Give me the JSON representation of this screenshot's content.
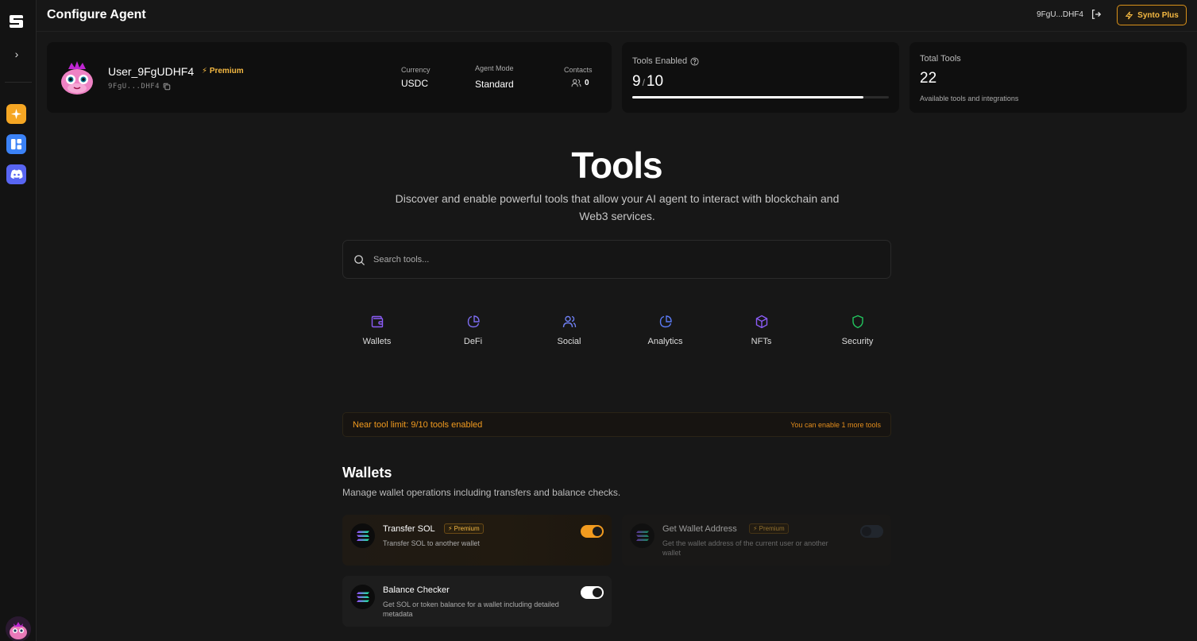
{
  "header": {
    "title": "Configure Agent",
    "wallet_short": "9FgU...DHF4",
    "plus_label": "Synto Plus"
  },
  "profile": {
    "username": "User_9FgUDHF4",
    "tier": "Premium",
    "address": "9FgU...DHF4",
    "currency_label": "Currency",
    "currency_value": "USDC",
    "mode_label": "Agent Mode",
    "mode_value": "Standard",
    "contacts_label": "Contacts",
    "contacts_value": "0"
  },
  "tools_enabled": {
    "label": "Tools Enabled",
    "enabled": "9",
    "separator": "/",
    "max": "10",
    "progress_fraction": 0.9
  },
  "total_tools": {
    "label": "Total Tools",
    "value": "22",
    "subtitle": "Available tools and integrations"
  },
  "hero": {
    "title": "Tools",
    "subtitle": "Discover and enable powerful tools that allow your AI agent to interact with blockchain and Web3 services."
  },
  "search": {
    "placeholder": "Search tools..."
  },
  "categories": [
    {
      "label": "Wallets",
      "icon": "wallet-icon",
      "color": "#8b5cf6"
    },
    {
      "label": "DeFi",
      "icon": "pie-chart-icon",
      "color": "#7c6cf0"
    },
    {
      "label": "Social",
      "icon": "users-icon",
      "color": "#6d7ef0"
    },
    {
      "label": "Analytics",
      "icon": "pie-chart-icon",
      "color": "#5b7bf5"
    },
    {
      "label": "NFTs",
      "icon": "cube-icon",
      "color": "#8b5cf6"
    },
    {
      "label": "Security",
      "icon": "shield-icon",
      "color": "#22c55e"
    }
  ],
  "limit_banner": {
    "message": "Near tool limit: 9/10 tools enabled",
    "hint": "You can enable 1 more tools"
  },
  "wallets_section": {
    "title": "Wallets",
    "subtitle": "Manage wallet operations including transfers and balance checks.",
    "tools": [
      {
        "name": "Transfer SOL",
        "badge": "Premium",
        "description": "Transfer SOL to another wallet",
        "enabled": true
      },
      {
        "name": "Get Wallet Address",
        "badge": "Premium",
        "description": "Get the wallet address of the current user or another wallet",
        "enabled": false
      },
      {
        "name": "Balance Checker",
        "badge": "",
        "description": "Get SOL or token balance for a wallet including detailed metadata",
        "enabled": true
      }
    ]
  },
  "colors": {
    "accent": "#f29b1f",
    "premium": "#f5b942",
    "background": "#171717"
  }
}
